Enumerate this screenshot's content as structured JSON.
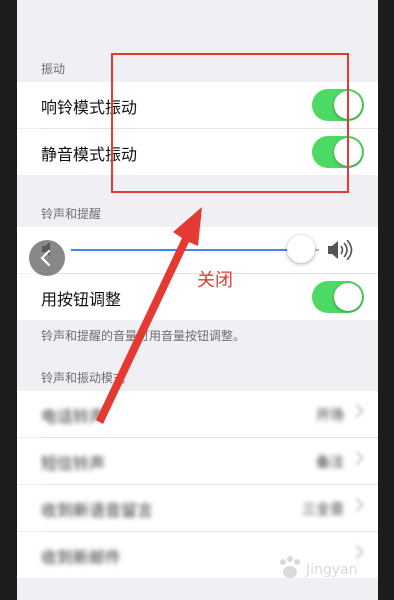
{
  "vibration": {
    "header": "振动",
    "items": [
      {
        "label": "响铃模式振动",
        "state": "on"
      },
      {
        "label": "静音模式振动",
        "state": "on"
      }
    ]
  },
  "ringtones_alerts": {
    "header": "铃声和提醒",
    "volume_level": 0.85,
    "change_with_buttons_label": "用按钮调整",
    "change_with_buttons_state": "on",
    "note": "铃声和提醒的音量可用音量按钮调整。"
  },
  "patterns": {
    "header": "铃声和振动模式",
    "items": [
      {
        "label": "电话铃声",
        "value": "开场"
      },
      {
        "label": "短信铃声",
        "value": "备注"
      },
      {
        "label": "收到新语音留言",
        "value": "三全音"
      },
      {
        "label": "收到新邮件",
        "value": ""
      }
    ]
  },
  "annotation": {
    "label": "关闭",
    "color": "#e43a32"
  },
  "colors": {
    "switch_on": "#4cd964",
    "slider_fill": "#3d89f0",
    "background": "#efeff4"
  },
  "icons": {
    "speaker_low": "speaker-low-icon",
    "speaker_high": "speaker-high-icon",
    "back": "chevron-left-icon",
    "chevron": "chevron-right-icon"
  },
  "watermark": {
    "text": "Jingyan"
  }
}
